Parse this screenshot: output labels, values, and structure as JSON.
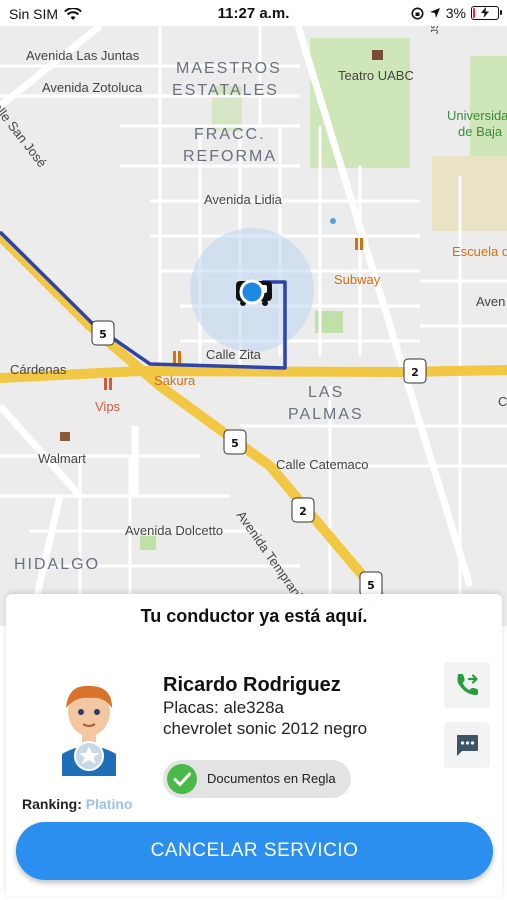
{
  "status_bar": {
    "carrier": "Sin SIM",
    "time": "11:27 a.m.",
    "battery": "3%",
    "battery_level": 0.03,
    "icons": [
      "wifi-icon",
      "orientation-lock-icon",
      "location-arrow-icon",
      "battery-charging-icon"
    ]
  },
  "map": {
    "labels": {
      "avenida_las_juntas": "Avenida Las Juntas",
      "avenida_zotoluca": "Avenida Zotoluca",
      "calle_san_jose": "Calle San José",
      "maestros": "MAESTROS",
      "estatales": "ESTATALES",
      "fracc": "FRACC.",
      "reforma": "REFORMA",
      "teatro_uabc": "Teatro UABC",
      "universidad": "Universidad",
      "de_baja": "de Baja",
      "jsco": "JSCO",
      "avenida_lidia": "Avenida Lidia",
      "escuela": "Escuela de",
      "subway": "Subway",
      "aven": "Aven",
      "calle_zita": "Calle Zita",
      "cardenas": "Cárdenas",
      "sakura": "Sakura",
      "vips": "Vips",
      "las": "LAS",
      "palmas": "PALMAS",
      "walmart": "Walmart",
      "calle_catemaco": "Calle Catemaco",
      "avenida_dolcetto": "Avenida Dolcetto",
      "avenida_tempranillo": "Avenida Tempranillo",
      "hidalgo": "HIDALGO",
      "c_edge": "C"
    },
    "shields": [
      "5",
      "2",
      "5",
      "2",
      "5"
    ],
    "colors": {
      "route": "#2f44a8",
      "highway": "#f2c744",
      "user_dot": "#1e88e5"
    }
  },
  "sheet": {
    "title": "Tu conductor ya está aquí.",
    "driver": {
      "name": "Ricardo Rodriguez",
      "plates": "Placas: ale328a",
      "vehicle": "chevrolet sonic 2012 negro"
    },
    "ranking_label": "Ranking:",
    "ranking_tier": "Platino",
    "docs_badge": "Documentos en Regla",
    "cancel_label": "CANCELAR SERVICIO",
    "colors": {
      "accent": "#2b8ff0",
      "call": "#2a9d3b",
      "check": "#4bb84a",
      "tier": "#9cc3e3"
    }
  }
}
